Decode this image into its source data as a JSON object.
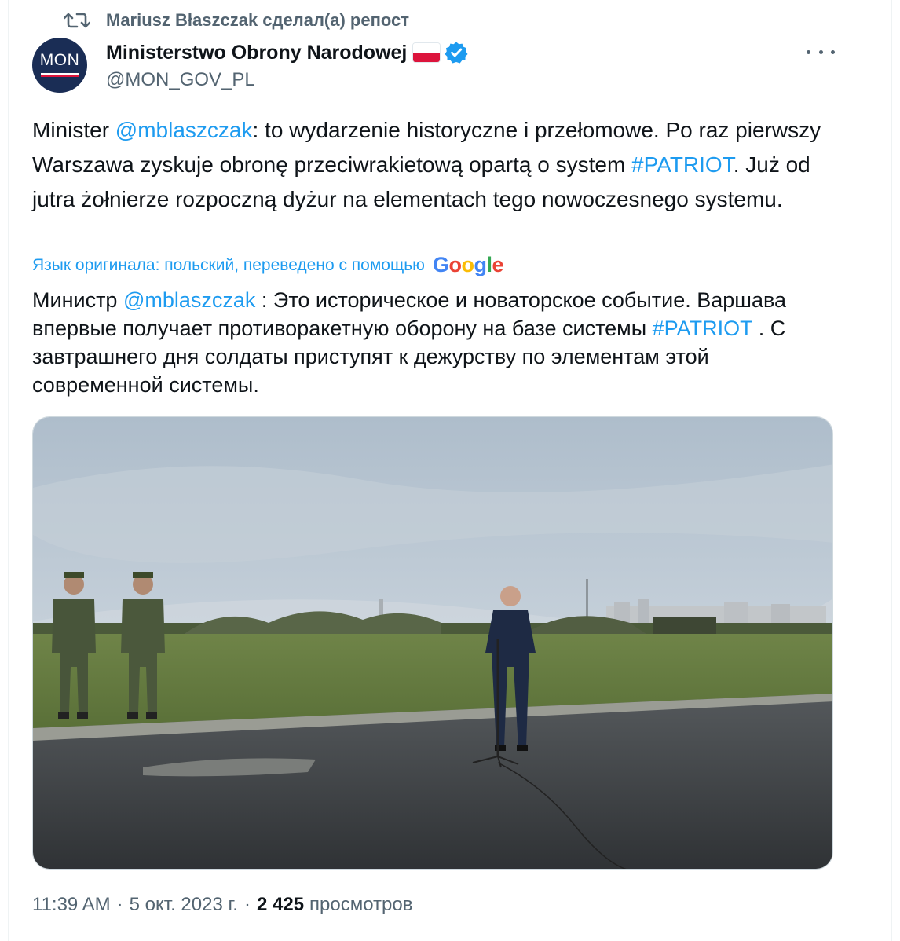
{
  "retweet": {
    "label": "Mariusz Błaszczak сделал(а) репост"
  },
  "author": {
    "avatar_text": "MON",
    "name": "Ministerstwo Obrony Narodowej",
    "handle": "@MON_GOV_PL",
    "flag_icon": "poland-flag-icon",
    "verified_icon": "verified-badge-icon"
  },
  "tweet": {
    "pl_part1": "Minister ",
    "pl_mention": "@mblaszczak",
    "pl_part2": ": to wydarzenie historyczne i przełomowe. Po raz pierwszy Warszawa zyskuje obronę przeciwrakietową opartą o system ",
    "pl_hashtag": "#PATRIOT",
    "pl_part3": ". Już od jutra żołnierze rozpoczną dyżur na elementach tego nowoczesnego systemu.",
    "translation_note": "Язык оригинала: польский, переведено с помощью",
    "translator_logo": "Google",
    "ru_part1": "Министр ",
    "ru_mention": "@mblaszczak",
    "ru_part2": " : Это историческое и новаторское событие. Варшава впервые получает противоракетную оборону на базе системы ",
    "ru_hashtag": "#PATRIOT",
    "ru_part3": " . С завтрашнего дня солдаты приступят к дежурству по элементам этой современной системы."
  },
  "meta": {
    "time": "11:39 AM",
    "date": "5 окт. 2023 г.",
    "views_count": "2 425",
    "views_label": "просмотров",
    "sep": "·"
  },
  "colors": {
    "link": "#1d9bf0",
    "secondary": "#536471",
    "primary": "#0f1419"
  }
}
